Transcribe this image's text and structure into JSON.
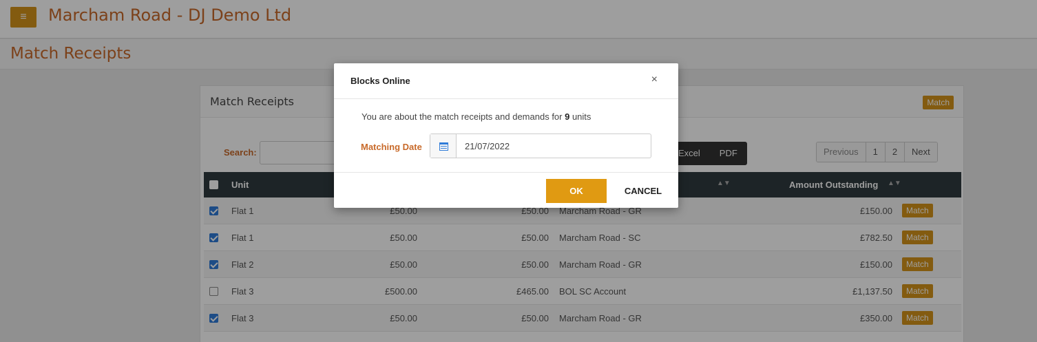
{
  "app": {
    "title": "Marcham Road - DJ Demo Ltd",
    "menu_icon": "hamburger-icon"
  },
  "page": {
    "title": "Match Receipts"
  },
  "panel": {
    "title": "Match Receipts",
    "match_label": "Match",
    "search_label": "Search:",
    "search_value": "",
    "export_buttons": [
      "Excel",
      "PDF"
    ],
    "pager": {
      "prev": "Previous",
      "pages": [
        "1",
        "2"
      ],
      "next": "Next"
    }
  },
  "table": {
    "columns": {
      "unit": "Unit",
      "amount_outstanding": "Amount Outstanding"
    },
    "rows": [
      {
        "checked": true,
        "unit": "Flat 1",
        "a": "£50.00",
        "b": "£50.00",
        "account": "Marcham Road - GR",
        "outstanding": "£150.00",
        "action": "Match"
      },
      {
        "checked": true,
        "unit": "Flat 1",
        "a": "£50.00",
        "b": "£50.00",
        "account": "Marcham Road - SC",
        "outstanding": "£782.50",
        "action": "Match"
      },
      {
        "checked": true,
        "unit": "Flat 2",
        "a": "£50.00",
        "b": "£50.00",
        "account": "Marcham Road - GR",
        "outstanding": "£150.00",
        "action": "Match"
      },
      {
        "checked": false,
        "unit": "Flat 3",
        "a": "£500.00",
        "b": "£465.00",
        "account": "BOL SC Account",
        "outstanding": "£1,137.50",
        "action": "Match"
      },
      {
        "checked": true,
        "unit": "Flat 3",
        "a": "£50.00",
        "b": "£50.00",
        "account": "Marcham Road - GR",
        "outstanding": "£350.00",
        "action": "Match"
      }
    ]
  },
  "modal": {
    "title": "Blocks Online",
    "close_icon": "close-icon",
    "message_prefix": "You are about the match receipts and demands for ",
    "unit_count": "9",
    "message_suffix": " units",
    "date_label": "Matching Date",
    "date_value": "21/07/2022",
    "ok_label": "OK",
    "cancel_label": "CANCEL"
  },
  "colors": {
    "brand": "#c86a2a",
    "accent": "#d4941a",
    "ok": "#e09a12",
    "table_header": "#2f3a40"
  }
}
